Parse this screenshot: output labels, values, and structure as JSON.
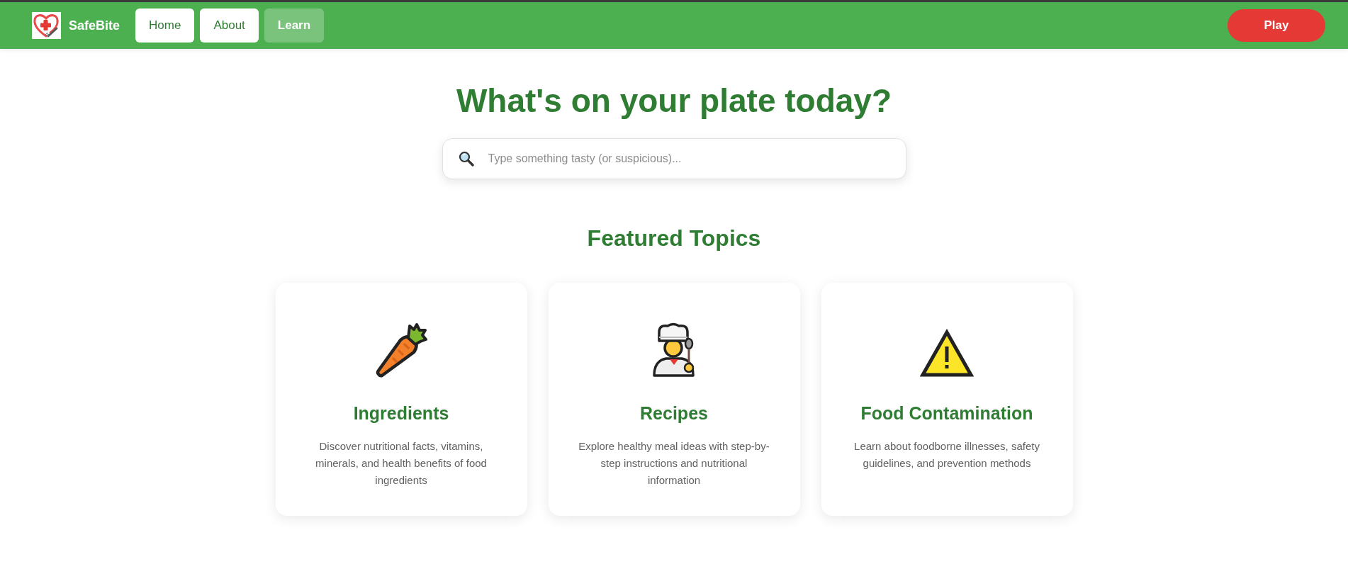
{
  "header": {
    "brand": "SafeBite",
    "nav": [
      {
        "label": "Home",
        "selected": false
      },
      {
        "label": "About",
        "selected": false
      },
      {
        "label": "Learn",
        "selected": true
      }
    ],
    "play_button": "Play"
  },
  "hero": {
    "title": "What's on your plate today?",
    "search": {
      "placeholder": "Type something tasty (or suspicious)..."
    }
  },
  "featured": {
    "heading": "Featured Topics",
    "cards": [
      {
        "kind": "ingredient",
        "title": "Ingredients",
        "description": "Discover nutritional facts, vitamins, minerals, and health benefits of food ingredients"
      },
      {
        "kind": "recipe",
        "title": "Recipes",
        "description": "Explore healthy meal ideas with step-by-step instructions and nutritional information"
      },
      {
        "kind": "hazard",
        "title": "Food Contamination",
        "description": "Learn about foodborne illnesses, safety guidelines, and prevention methods"
      }
    ]
  }
}
